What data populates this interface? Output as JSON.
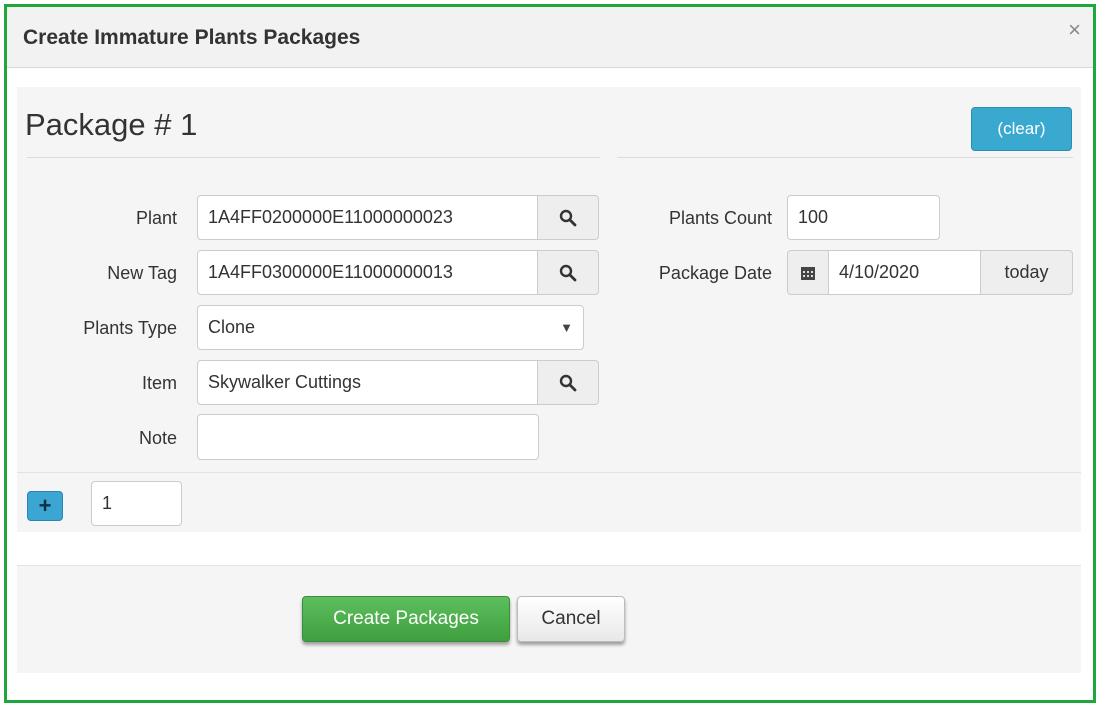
{
  "modal": {
    "title": "Create Immature Plants Packages",
    "close_glyph": "×"
  },
  "package": {
    "heading": "Package # 1",
    "clear_label": "(clear)",
    "fields": {
      "plant_label": "Plant",
      "plant_value": "1A4FF0200000E11000000023",
      "new_tag_label": "New Tag",
      "new_tag_value": "1A4FF0300000E11000000013",
      "plants_type_label": "Plants Type",
      "plants_type_value": "Clone",
      "item_label": "Item",
      "item_value": "Skywalker Cuttings",
      "note_label": "Note",
      "note_value": "",
      "plants_count_label": "Plants Count",
      "plants_count_value": "100",
      "package_date_label": "Package Date",
      "package_date_value": "4/10/2020",
      "today_label": "today"
    }
  },
  "add_packages": {
    "plus_glyph": "+",
    "count_value": "1"
  },
  "footer": {
    "create_label": "Create Packages",
    "cancel_label": "Cancel"
  },
  "colors": {
    "frame_border": "#1ea73c",
    "info_button": "#39a9d0",
    "success_button": "#4cae4c"
  },
  "icons": {
    "close": "close-icon",
    "search": "search-icon",
    "calendar": "calendar-icon",
    "dropdown": "chevron-down-icon",
    "plus": "plus-icon"
  }
}
